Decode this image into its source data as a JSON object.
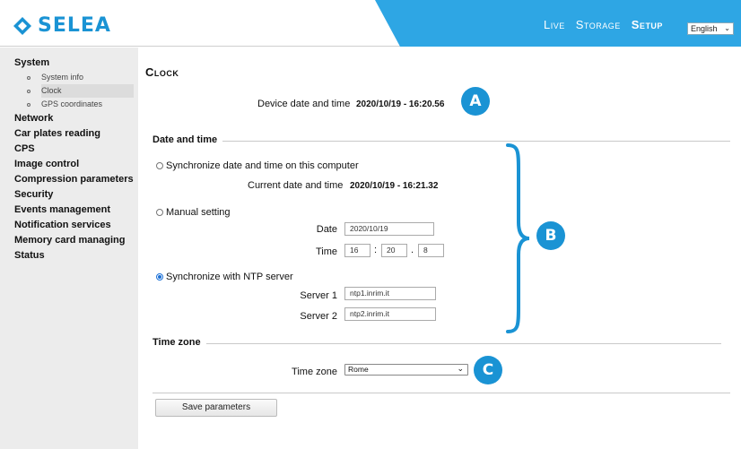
{
  "header": {
    "brand": "SELEA",
    "nav": [
      {
        "label": "Live",
        "active": false
      },
      {
        "label": "Storage",
        "active": false
      },
      {
        "label": "Setup",
        "active": true
      }
    ],
    "language": "English"
  },
  "sidebar": {
    "sections": [
      {
        "label": "System",
        "items": [
          "System info",
          "Clock",
          "GPS coordinates"
        ],
        "selected": "Clock"
      },
      {
        "label": "Network"
      },
      {
        "label": "Car plates reading"
      },
      {
        "label": "CPS"
      },
      {
        "label": "Image control"
      },
      {
        "label": "Compression parameters"
      },
      {
        "label": "Security"
      },
      {
        "label": "Events management"
      },
      {
        "label": "Notification services"
      },
      {
        "label": "Memory card managing"
      },
      {
        "label": "Status"
      }
    ]
  },
  "main": {
    "title": "Clock",
    "device_datetime_label": "Device date and time",
    "device_datetime_value": "2020/10/19 - 16:20.56",
    "date_time_section": "Date and time",
    "sync_computer_label": "Synchronize date and time on this computer",
    "current_datetime_label": "Current date and time",
    "current_datetime_value": "2020/10/19 - 16:21.32",
    "manual_label": "Manual setting",
    "date_label": "Date",
    "date_value": "2020/10/19",
    "time_label": "Time",
    "time_h": "16",
    "time_m": "20",
    "time_s": "8",
    "time_sep1": ":",
    "time_sep2": ".",
    "ntp_label": "Synchronize with NTP server",
    "server1_label": "Server 1",
    "server1_value": "ntp1.inrim.it",
    "server2_label": "Server 2",
    "server2_value": "ntp2.inrim.it",
    "selected_mode": "ntp",
    "timezone_section": "Time zone",
    "timezone_label": "Time zone",
    "timezone_value": "Rome",
    "save_label": "Save parameters"
  },
  "annotations": {
    "a": "A",
    "b": "B",
    "c": "C",
    "color": "#1a93d4"
  }
}
